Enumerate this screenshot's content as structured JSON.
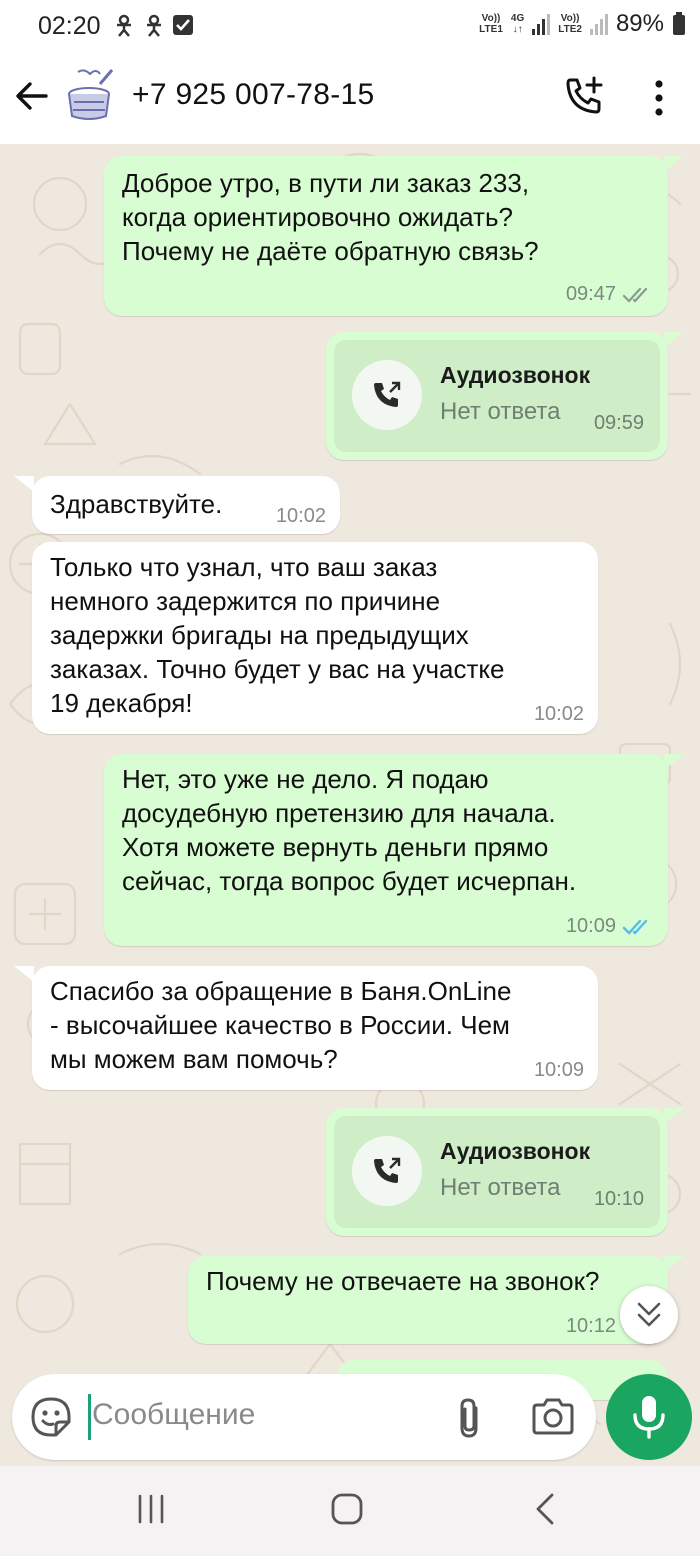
{
  "status_bar": {
    "time": "02:20",
    "net1_top": "Vo))",
    "net1_bottom": "LTE1",
    "net_4g": "4G",
    "net2_top": "Vo))",
    "net2_bottom": "LTE2",
    "battery": "89%"
  },
  "header": {
    "contact": "+7 925 007-78-15"
  },
  "messages": [
    {
      "id": "m1",
      "side": "out",
      "text": "Доброе утро,  в пути ли заказ 233,\nкогда ориентировочно ожидать?\nПочему не даёте обратную связь?",
      "time": "09:47",
      "status": "read-grey"
    },
    {
      "id": "m2",
      "side": "out",
      "type": "call",
      "title": "Аудиозвонок",
      "subtitle": "Нет ответа",
      "time": "09:59"
    },
    {
      "id": "m3",
      "side": "in",
      "text": "Здравствуйте.",
      "time": "10:02"
    },
    {
      "id": "m4",
      "side": "in",
      "text": "Только что узнал, что ваш заказ\nнемного задержится по причине\nзадержки бригады на предыдущих\nзаказах. Точно будет у вас на участке\n19 декабря!",
      "time": "10:02"
    },
    {
      "id": "m5",
      "side": "out",
      "text": "Нет, это уже не дело. Я подаю\nдосудебную претензию для начала.\nХотя можете вернуть деньги прямо\nсейчас, тогда вопрос будет исчерпан.",
      "time": "10:09",
      "status": "read-blue"
    },
    {
      "id": "m6",
      "side": "in",
      "text": "Спасибо за обращение в Баня.OnLine\n- высочайшее качество в России. Чем\nмы можем вам помочь?",
      "time": "10:09"
    },
    {
      "id": "m7",
      "side": "out",
      "type": "call",
      "title": "Аудиозвонок",
      "subtitle": "Нет ответа",
      "time": "10:10"
    },
    {
      "id": "m8",
      "side": "out",
      "text": "Почему не отвечаете на звонок?",
      "time": "10:12",
      "status": "read-blue"
    }
  ],
  "composer": {
    "placeholder": "Сообщение"
  },
  "colors": {
    "accent": "#1aa560",
    "outgoing_bubble": "#d9fdd3",
    "incoming_bubble": "#ffffff",
    "chat_background": "#efe8de",
    "read_tick_blue": "#53bdeb"
  },
  "icons": [
    "back-arrow-icon",
    "avatar",
    "add-call-icon",
    "more-vert-icon",
    "call-outgoing-icon",
    "double-chevron-down-icon",
    "sticker-icon",
    "attach-icon",
    "camera-icon",
    "mic-icon",
    "nav-recent-icon",
    "nav-home-icon",
    "nav-back-icon"
  ]
}
